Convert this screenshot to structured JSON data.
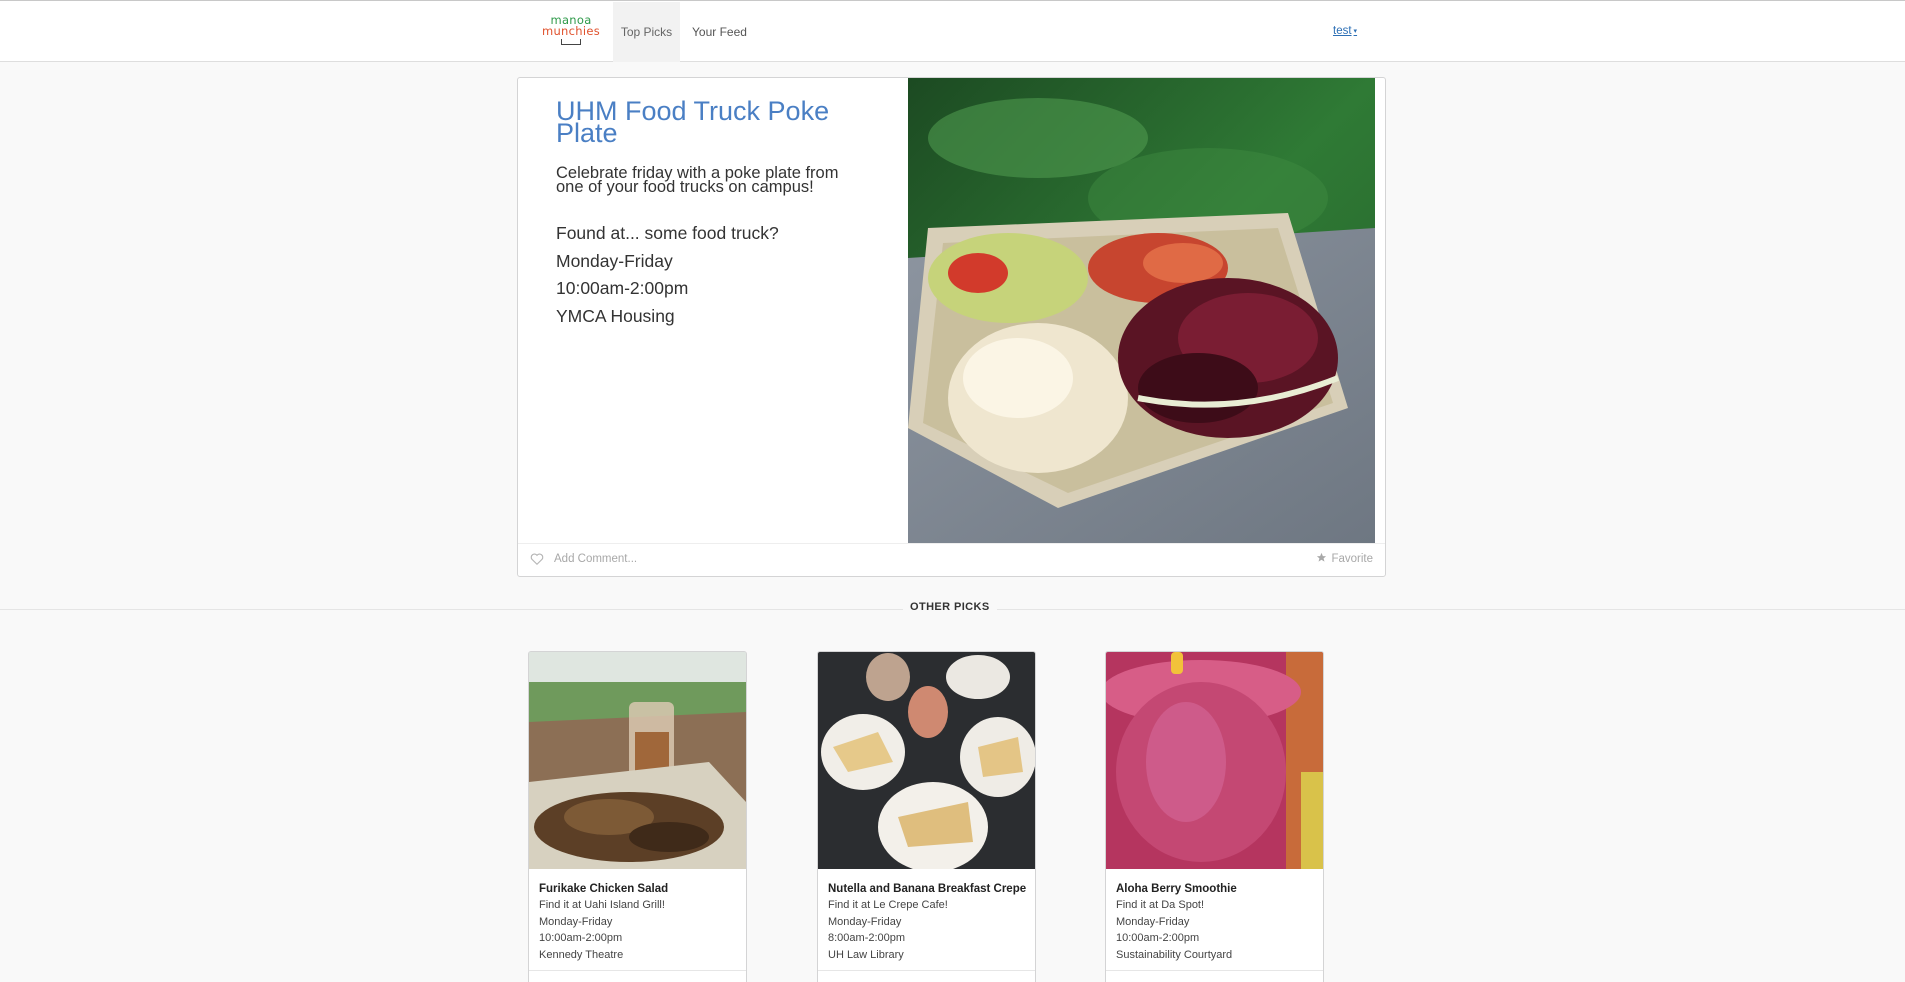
{
  "navbar": {
    "logo": {
      "line1": "manoa",
      "line2": "munchies"
    },
    "items": [
      {
        "label": "Top Picks"
      },
      {
        "label": "Your Feed"
      }
    ],
    "user": {
      "label": "test",
      "caret": "▾"
    }
  },
  "featured": {
    "title": "UHM Food Truck Poke Plate",
    "description": "Celebrate friday with a poke plate from one of your food trucks on campus!",
    "location": "Found at... some food truck?",
    "days": "Monday-Friday",
    "hours": "10:00am-2:00pm",
    "place": "YMCA Housing",
    "add_comment": "Add Comment...",
    "favorite": "Favorite"
  },
  "section": {
    "label": "OTHER PICKS"
  },
  "picks": [
    {
      "title": "Furikake Chicken Salad",
      "location": "Find it at Uahi Island Grill!",
      "days": "Monday-Friday",
      "hours": "10:00am-2:00pm",
      "place": "Kennedy Theatre"
    },
    {
      "title": "Nutella and Banana Breakfast Crepe",
      "location": "Find it at Le Crepe Cafe!",
      "days": "Monday-Friday",
      "hours": "8:00am-2:00pm",
      "place": "UH Law Library"
    },
    {
      "title": "Aloha Berry Smoothie",
      "location": "Find it at Da Spot!",
      "days": "Monday-Friday",
      "hours": "10:00am-2:00pm",
      "place": "Sustainability Courtyard"
    }
  ],
  "colors": {
    "title_blue": "#4a7fc4",
    "link_blue": "#2c6fb5",
    "logo_green": "#2f9a4a",
    "logo_orange": "#e0522d"
  }
}
